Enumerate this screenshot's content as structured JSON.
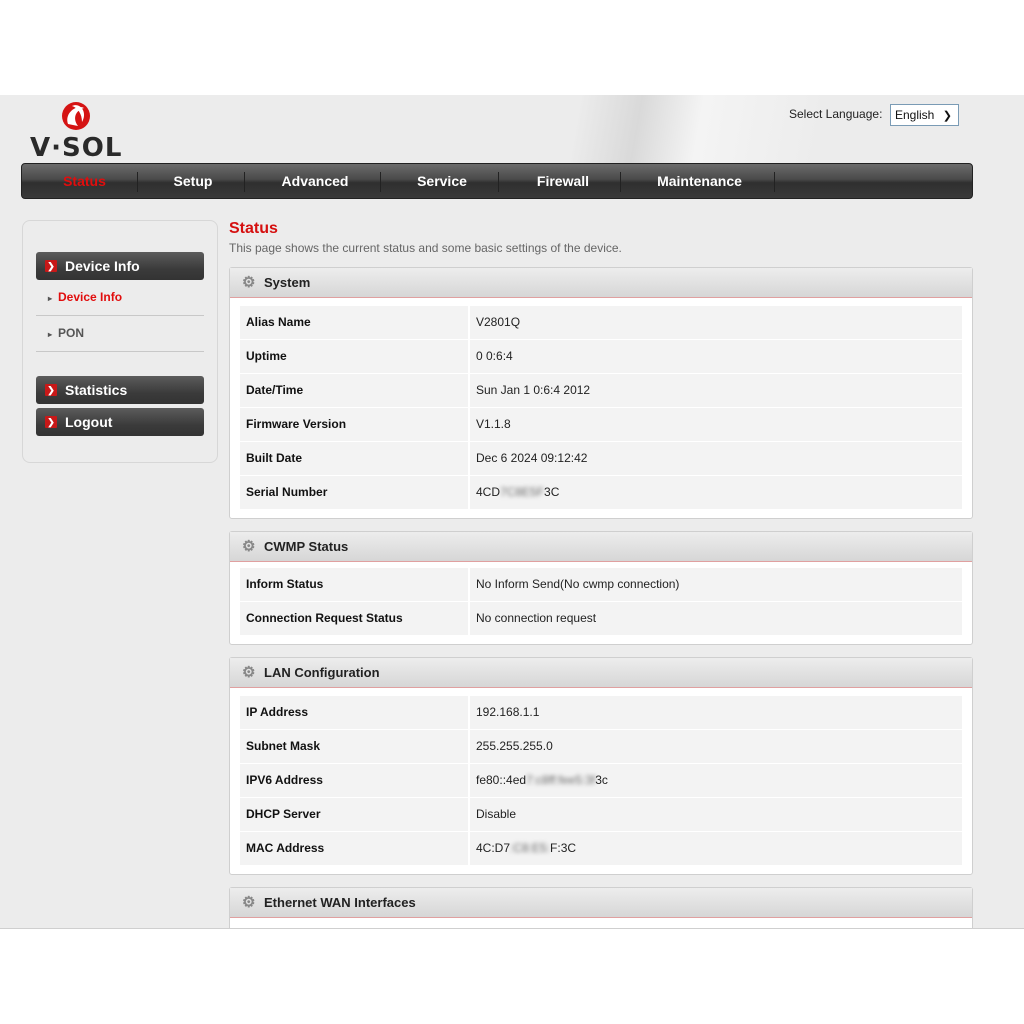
{
  "brand": {
    "logo_text": "V·SOL",
    "accent": "#d50f0f"
  },
  "language": {
    "label": "Select Language:",
    "selected": "English"
  },
  "nav": {
    "items": [
      {
        "label": "Status",
        "active": true
      },
      {
        "label": "Setup"
      },
      {
        "label": "Advanced"
      },
      {
        "label": "Service"
      },
      {
        "label": "Firewall"
      },
      {
        "label": "Maintenance"
      }
    ]
  },
  "sidebar": {
    "device_info": "Device Info",
    "sub_items": [
      {
        "label": "Device Info",
        "active": true
      },
      {
        "label": "PON"
      }
    ],
    "statistics": "Statistics",
    "logout": "Logout"
  },
  "page": {
    "title": "Status",
    "description": "This page shows the current status and some basic settings of the device."
  },
  "system": {
    "title": "System",
    "rows": [
      {
        "k": "Alias Name",
        "v": "V2801Q"
      },
      {
        "k": "Uptime",
        "v": "0 0:6:4"
      },
      {
        "k": "Date/Time",
        "v": "Sun Jan 1 0:6:4 2012"
      },
      {
        "k": "Firmware Version",
        "v": "V1.1.8"
      },
      {
        "k": "Built Date",
        "v": "Dec 6 2024 09:12:42"
      },
      {
        "k": "Serial Number",
        "v_pre": "4CD",
        "v_blur": "7C8E5F",
        "v_post": "3C"
      }
    ]
  },
  "cwmp": {
    "title": "CWMP Status",
    "rows": [
      {
        "k": "Inform Status",
        "v": "No Inform Send(No cwmp connection)"
      },
      {
        "k": "Connection Request Status",
        "v": "No connection request"
      }
    ]
  },
  "lan": {
    "title": "LAN Configuration",
    "rows": [
      {
        "k": "IP Address",
        "v": "192.168.1.1"
      },
      {
        "k": "Subnet Mask",
        "v": "255.255.255.0"
      },
      {
        "k": "IPV6 Address",
        "v_pre": "fe80::4ed",
        "v_blur": "7:c8ff:fee5:3f",
        "v_post": "3c"
      },
      {
        "k": "DHCP Server",
        "v": "Disable"
      },
      {
        "k": "MAC Address",
        "v_pre": "4C:D7",
        "v_blur": ":C8:E5:",
        "v_post": "F:3C"
      }
    ]
  },
  "wan": {
    "title": "Ethernet WAN Interfaces"
  }
}
